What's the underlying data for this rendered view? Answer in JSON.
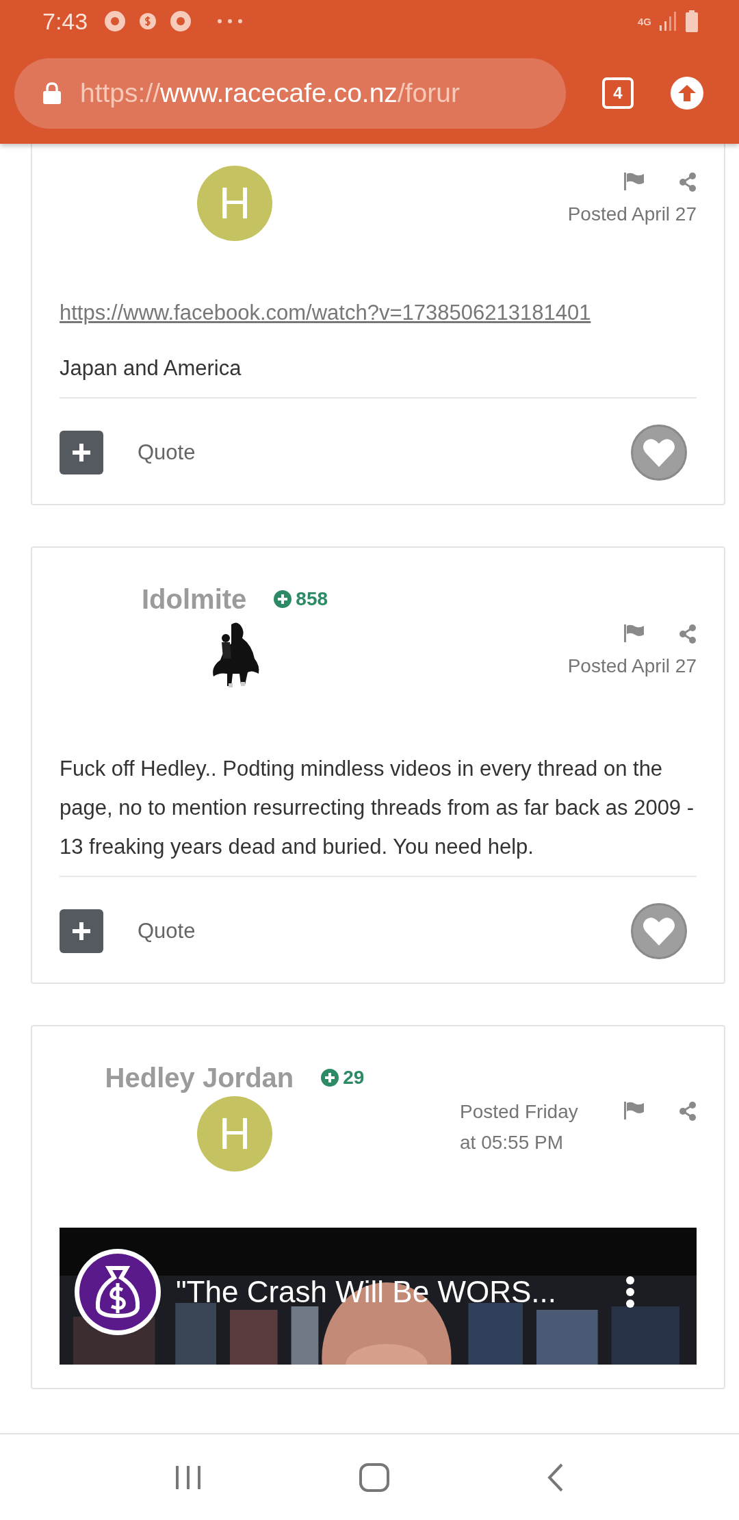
{
  "status_bar": {
    "time": "7:43",
    "network": "4G"
  },
  "browser": {
    "url": {
      "scheme": "https://",
      "host": "www.racecafe.co.nz",
      "path": "/forur"
    },
    "tab_count": "4"
  },
  "posts": [
    {
      "kind": "date-below",
      "avatar": {
        "kind": "letter",
        "letter": "H",
        "color": "#c5c262"
      },
      "posted": "Posted April 27",
      "body": [
        {
          "kind": "link",
          "text": "https://www.facebook.com/watch?v=1738506213181401"
        },
        {
          "kind": "text",
          "text": "Japan and America"
        }
      ],
      "footer": {
        "quote": "Quote"
      }
    },
    {
      "kind": "date-below",
      "author": "Idolmite",
      "reputation": "858",
      "avatar": {
        "kind": "picture"
      },
      "posted": "Posted April 27",
      "body": [
        {
          "kind": "text",
          "text": "Fuck off Hedley.. Podting mindless videos in every thread on the page, no to mention resurrecting threads from as far back as 2009 - 13 freaking years dead and buried. You need help."
        }
      ],
      "footer": {
        "quote": "Quote"
      }
    },
    {
      "kind": "date-beside",
      "author": "Hedley Jordan",
      "reputation": "29",
      "avatar": {
        "kind": "letter",
        "letter": "H",
        "color": "#c5c262"
      },
      "posted": "Posted Friday at 05:55 PM",
      "body": [
        {
          "kind": "video",
          "title": "\"The Crash Will Be WORS..."
        }
      ]
    }
  ]
}
